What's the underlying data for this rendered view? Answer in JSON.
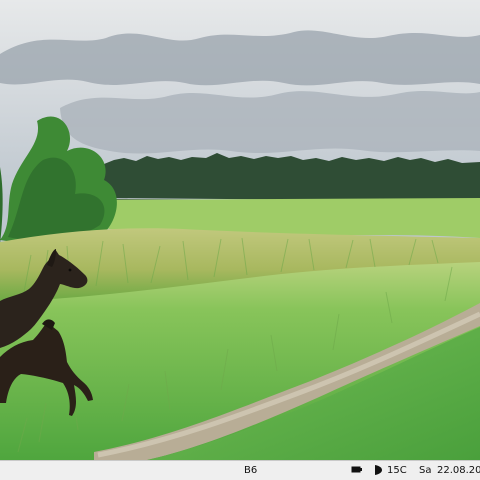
{
  "scene": {
    "subject_count": 2,
    "colors": {
      "sky": "#c8ced6",
      "cloud_dark": "#8e98a3",
      "forest": "#2f4d35",
      "field": "#8fc55a",
      "meadow": "#a9b86a",
      "track": "#b8ad96",
      "deer": "#2b231c",
      "tree": "#3f7f34"
    }
  },
  "status_bar": {
    "camera_id": "B6",
    "battery_icon": "battery-icon",
    "moon_icon": "moon-phase-icon",
    "temperature": "15C",
    "weekday": "Sa",
    "date": "22.08.20"
  }
}
